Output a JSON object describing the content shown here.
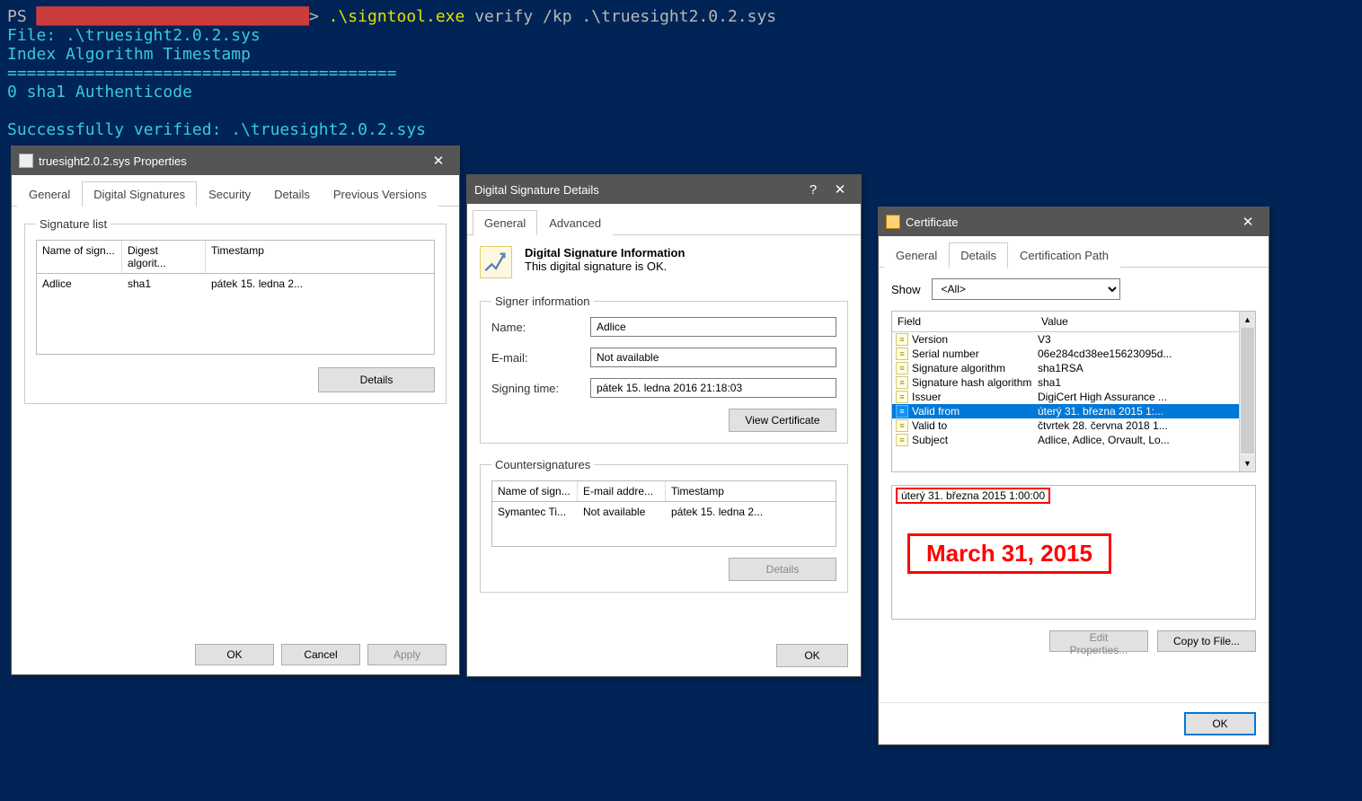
{
  "terminal": {
    "prompt": "PS ",
    "path_blur": "████████████████████████████",
    "arrow": ">",
    "cmd_exe": " .\\signtool.exe",
    "cmd_args": " verify /kp .\\truesight2.0.2.sys",
    "line_file": "File: .\\truesight2.0.2.sys",
    "line_head": "Index  Algorithm  Timestamp",
    "line_sep": "========================================",
    "line_row": "0      sha1       Authenticode",
    "line_ok": "Successfully verified: .\\truesight2.0.2.sys"
  },
  "props": {
    "title": "truesight2.0.2.sys Properties",
    "tabs": [
      "General",
      "Digital Signatures",
      "Security",
      "Details",
      "Previous Versions"
    ],
    "activeTabIndex": 1,
    "siglist_legend": "Signature list",
    "siglist_cols": [
      "Name of sign...",
      "Digest algorit...",
      "Timestamp"
    ],
    "siglist_row": [
      "Adlice",
      "sha1",
      "pátek 15. ledna 2..."
    ],
    "details_btn": "Details",
    "ok": "OK",
    "cancel": "Cancel",
    "apply": "Apply"
  },
  "sigdetails": {
    "title": "Digital Signature Details",
    "help": "?",
    "tabs": [
      "General",
      "Advanced"
    ],
    "info_title": "Digital Signature Information",
    "info_text": "This digital signature is OK.",
    "signer_legend": "Signer information",
    "name_lbl": "Name:",
    "name_val": "Adlice",
    "email_lbl": "E-mail:",
    "email_val": "Not available",
    "time_lbl": "Signing time:",
    "time_val": "pátek 15. ledna 2016 21:18:03",
    "view_cert": "View Certificate",
    "counter_legend": "Countersignatures",
    "counter_cols": [
      "Name of sign...",
      "E-mail addre...",
      "Timestamp"
    ],
    "counter_row": [
      "Symantec Ti...",
      "Not available",
      "pátek 15. ledna 2..."
    ],
    "details_btn": "Details",
    "ok": "OK"
  },
  "cert": {
    "title": "Certificate",
    "tabs": [
      "General",
      "Details",
      "Certification Path"
    ],
    "activeTabIndex": 1,
    "show_lbl": "Show",
    "show_val": "<All>",
    "cols": [
      "Field",
      "Value"
    ],
    "rows": [
      {
        "f": "Version",
        "v": "V3"
      },
      {
        "f": "Serial number",
        "v": "06e284cd38ee15623095d..."
      },
      {
        "f": "Signature algorithm",
        "v": "sha1RSA"
      },
      {
        "f": "Signature hash algorithm",
        "v": "sha1"
      },
      {
        "f": "Issuer",
        "v": "DigiCert High Assurance ..."
      },
      {
        "f": "Valid from",
        "v": "úterý 31. března 2015 1:..."
      },
      {
        "f": "Valid to",
        "v": "čtvrtek 28. června 2018 1..."
      },
      {
        "f": "Subject",
        "v": "Adlice, Adlice, Orvault, Lo..."
      }
    ],
    "selectedIndex": 5,
    "detail_value": "úterý 31. března 2015 1:00:00",
    "edit_btn": "Edit Properties...",
    "copy_btn": "Copy to File...",
    "ok": "OK"
  },
  "annotation": "March 31, 2015"
}
